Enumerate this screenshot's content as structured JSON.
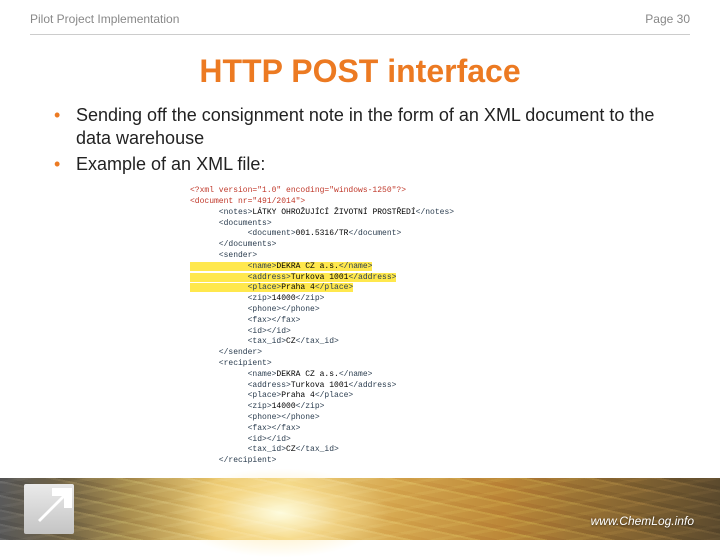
{
  "header": {
    "left": "Pilot Project Implementation",
    "right": "Page 30"
  },
  "title": "HTTP POST interface",
  "bullets": [
    "Sending off the consignment note in the form of an XML document to the data warehouse",
    "Example of an XML file:"
  ],
  "code": {
    "l1": "<?xml version=\"1.0\" encoding=\"windows-1250\"?>",
    "l2": "<document nr=\"491/2014\">",
    "l3a": "      <notes>",
    "l3b": "LÁTKY OHROŽUJÍCÍ ŽIVOTNÍ PROSTŘEDÍ",
    "l3c": "</notes>",
    "l4": "      <documents>",
    "l5a": "            <document>",
    "l5b": "001.5316/TR",
    "l5c": "</document>",
    "l6": "      </documents>",
    "l7": "      <sender>",
    "l8a": "            <name>",
    "l8b": "DEKRA CZ a.s.",
    "l8c": "</name>",
    "l9a": "            <address>",
    "l9b": "Turkova 1001",
    "l9c": "</address>",
    "l10a": "            <place>",
    "l10b": "Praha 4",
    "l10c": "</place>",
    "l11a": "            <zip>",
    "l11b": "14000",
    "l11c": "</zip>",
    "l12": "            <phone></phone>",
    "l13": "            <fax></fax>",
    "l14": "            <id></id>",
    "l15a": "            <tax_id>",
    "l15b": "CZ",
    "l15c": "</tax_id>",
    "l16": "      </sender>",
    "l17": "      <recipient>",
    "l18a": "            <name>",
    "l18b": "DEKRA CZ a.s.",
    "l18c": "</name>",
    "l19a": "            <address>",
    "l19b": "Turkova 1001",
    "l19c": "</address>",
    "l20a": "            <place>",
    "l20b": "Praha 4",
    "l20c": "</place>",
    "l21a": "            <zip>",
    "l21b": "14000",
    "l21c": "</zip>",
    "l22": "            <phone></phone>",
    "l23": "            <fax></fax>",
    "l24": "            <id></id>",
    "l25a": "            <tax_id>",
    "l25b": "CZ",
    "l25c": "</tax_id>",
    "l26": "      </recipient>"
  },
  "footer": {
    "url": "www.ChemLog.info"
  }
}
